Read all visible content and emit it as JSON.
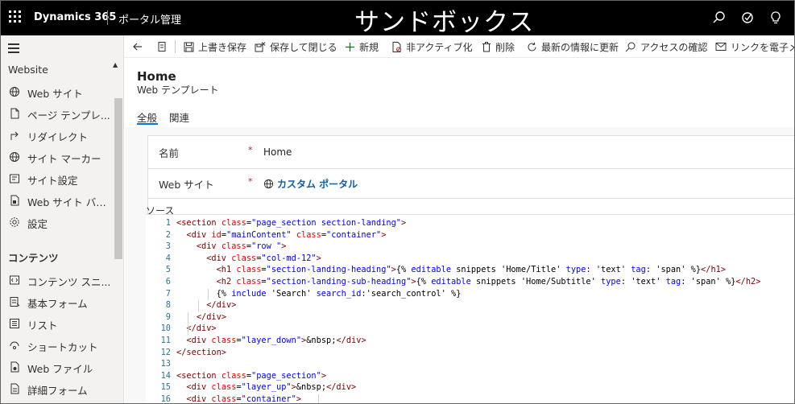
{
  "topbar": {
    "app_name": "Dynamics 365",
    "area_name": "ポータル管理",
    "environment_banner": "サンドボックス",
    "icons": [
      "search-icon",
      "task-icon",
      "lightbulb-icon"
    ]
  },
  "sitemap": {
    "group_website": "Website",
    "website_items": [
      {
        "label": "Web サイト",
        "icon": "globe-icon"
      },
      {
        "label": "ページ テンプレ...",
        "icon": "page-icon"
      },
      {
        "label": "リダイレクト",
        "icon": "redirect-icon"
      },
      {
        "label": "サイト マーカー",
        "icon": "globe-icon"
      },
      {
        "label": "サイト設定",
        "icon": "settings-list-icon"
      },
      {
        "label": "Web サイト バイ...",
        "icon": "document-icon"
      },
      {
        "label": "設定",
        "icon": "gear-icon"
      }
    ],
    "group_content": "コンテンツ",
    "content_items": [
      {
        "label": "コンテンツ スニ...",
        "icon": "snippet-icon"
      },
      {
        "label": "基本フォーム",
        "icon": "form-icon"
      },
      {
        "label": "リスト",
        "icon": "list-icon"
      },
      {
        "label": "ショートカット",
        "icon": "shortcut-icon"
      },
      {
        "label": "Web ファイル",
        "icon": "file-icon"
      },
      {
        "label": "詳細フォーム",
        "icon": "advanced-form-icon"
      }
    ]
  },
  "commandbar": {
    "save": "上書き保存",
    "save_close": "保存して閉じる",
    "new": "新規",
    "deactivate": "非アクティブ化",
    "delete": "削除",
    "refresh": "最新の情報に更新",
    "check_access": "アクセスの確認",
    "email_link": "リンクを電子メー"
  },
  "record": {
    "title": "Home",
    "entity": "Web テンプレート",
    "tabs": [
      "全般",
      "関連"
    ]
  },
  "form": {
    "name_label": "名前",
    "name_value": "Home",
    "website_label": "Web サイト",
    "website_value": "カスタム ポータル",
    "required_marker": "*",
    "source_label": "ソース"
  },
  "source_code": [
    "<section class=\"page_section section-landing\">",
    "  <div id=\"mainContent\" class=\"container\">",
    "    <div class=\"row \">",
    "      <div class=\"col-md-12\">",
    "        <h1 class=\"section-landing-heading\">{% editable snippets 'Home/Title' type: 'text' tag: 'span' %}</h1>",
    "        <h2 class=\"section-landing-sub-heading\">{% editable snippets 'Home/Subtitle' type: 'text' tag: 'span' %}</h2>",
    "        {% include 'Search' search_id:'search_control' %}",
    "      </div>",
    "    </div>",
    "  </div>",
    "  <div class=\"layer_down\">&nbsp;</div>",
    "</section>",
    "",
    "<section class=\"page_section\">",
    "  <div class=\"layer_up\">&nbsp;</div>",
    "  <div class=\"container\">"
  ],
  "source_line_numbers": [
    "1",
    "2",
    "3",
    "4",
    "5",
    "6",
    "7",
    "8",
    "9",
    "10",
    "11",
    "12",
    "13",
    "14",
    "15",
    "16"
  ],
  "colors": {
    "topbar": "#000000",
    "accent": "#0078d4",
    "link": "#115ea3",
    "required": "#a4262c"
  }
}
